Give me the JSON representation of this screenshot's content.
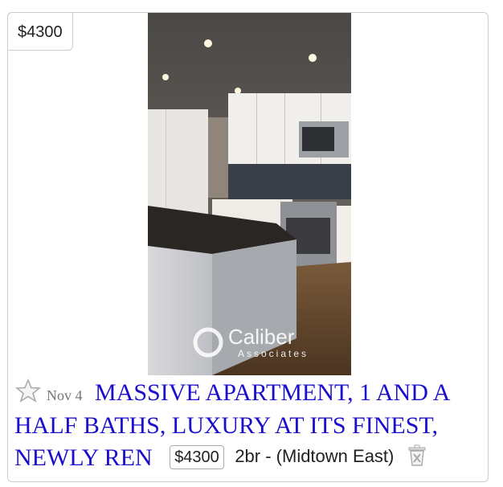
{
  "listing": {
    "price": "$4300",
    "date": "Nov 4",
    "title": "MASSIVE APARTMENT, 1 AND A HALF BATHS, LUXURY AT ITS FINEST, NEWLY REN",
    "inline_price": "$4300",
    "details": "2br - (Midtown East)",
    "watermark": {
      "line1": "Caliber",
      "line2": "Associates"
    }
  },
  "icons": {
    "favorite": "star-icon",
    "hide": "trash-icon"
  },
  "colors": {
    "link": "#1a0dcc",
    "border": "#cccccc",
    "star_outline": "#aaaaaa"
  }
}
